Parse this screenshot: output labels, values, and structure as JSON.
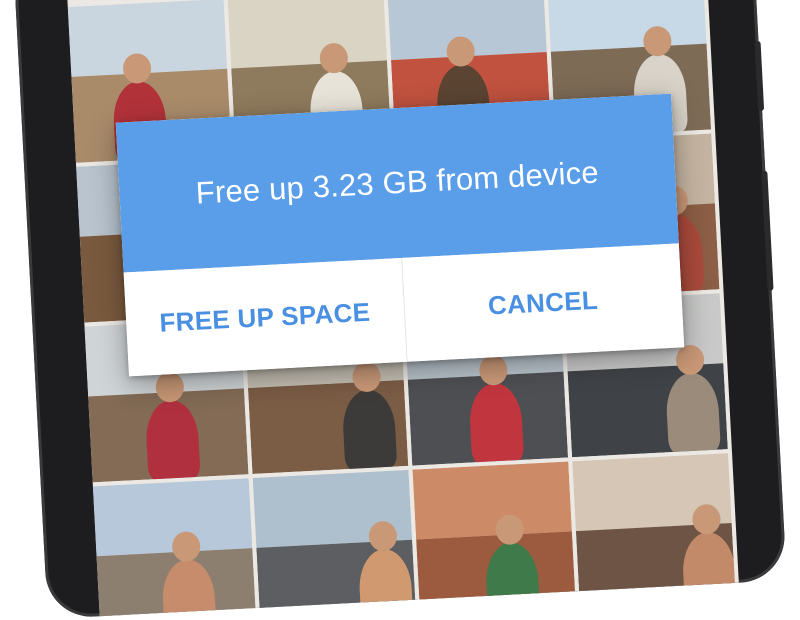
{
  "dialog": {
    "title": "Free up 3.23 GB from device",
    "primary_action": "FREE UP SPACE",
    "secondary_action": "CANCEL"
  },
  "colors": {
    "dialog_header": "#5a9de8",
    "action_text": "#4a90e2",
    "phone_frame": "#1d1d1f"
  },
  "photo_grid": {
    "tiles": [
      {
        "name": "campsite-photo",
        "sky": "#c9d5df",
        "ground": "#a98b6a",
        "fig": "#b2323a"
      },
      {
        "name": "horse-photo",
        "sky": "#d9d4c4",
        "ground": "#8e7a5c",
        "fig": "#e8e3d8"
      },
      {
        "name": "cowboy-family-photo",
        "sky": "#b7c7d6",
        "ground": "#c0523f",
        "fig": "#5b4432"
      },
      {
        "name": "woman-waving-photo",
        "sky": "#c7d8e6",
        "ground": "#7d6b56",
        "fig": "#d9d3c9"
      },
      {
        "name": "desert-rider-photo",
        "sky": "#b9c4cf",
        "ground": "#7a5a3e",
        "fig": "#4f3f33"
      },
      {
        "name": "rock-photo",
        "sky": "#c7b8a6",
        "ground": "#94745a",
        "fig": "#6d4d3a"
      },
      {
        "name": "rider-photo",
        "sky": "#d3cec4",
        "ground": "#8a6f55",
        "fig": "#3c3734"
      },
      {
        "name": "canyon-photo",
        "sky": "#c4b3a0",
        "ground": "#8b5e45",
        "fig": "#a94a3c"
      },
      {
        "name": "horseback-photo",
        "sky": "#cfd4d6",
        "ground": "#836b55",
        "fig": "#b13040"
      },
      {
        "name": "boots-photo",
        "sky": "#c5bfb3",
        "ground": "#7b5c45",
        "fig": "#3d3b3a"
      },
      {
        "name": "truck-photo",
        "sky": "#b8c3cb",
        "ground": "#4d4f53",
        "fig": "#c1363e"
      },
      {
        "name": "jeep-photo",
        "sky": "#c8c9c8",
        "ground": "#3f4246",
        "fig": "#9a8b7b"
      },
      {
        "name": "family-selfie-photo",
        "sky": "#b6c8da",
        "ground": "#8c7f70",
        "fig": "#c78c6b"
      },
      {
        "name": "kid-jeep-photo",
        "sky": "#aebfce",
        "ground": "#5c5e61",
        "fig": "#d0996f"
      },
      {
        "name": "red-rocks-photo",
        "sky": "#cc8a66",
        "ground": "#9c5a3e",
        "fig": "#3f7a4a"
      },
      {
        "name": "couple-selfie-photo",
        "sky": "#d6c6b5",
        "ground": "#6e5445",
        "fig": "#c28a68"
      }
    ]
  }
}
